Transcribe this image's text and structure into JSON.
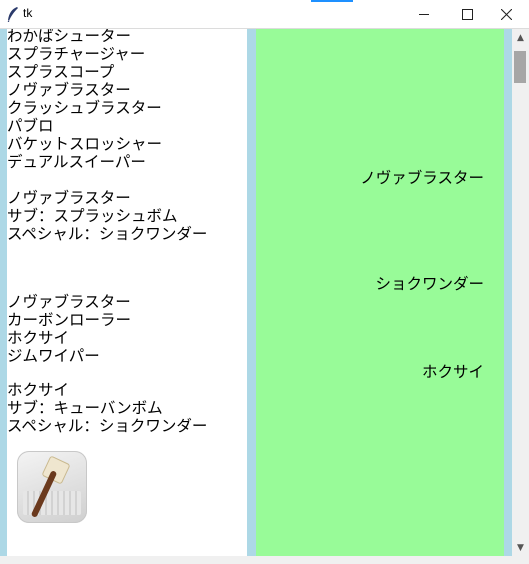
{
  "window": {
    "title": "tk",
    "icon": "feather-icon",
    "buttons": [
      "minimize",
      "maximize",
      "close"
    ]
  },
  "left_panel": {
    "background": "#ffffff",
    "lines": [
      "わかばシューター",
      "スプラチャージャー",
      "スプラスコープ",
      "ノヴァブラスター",
      "クラッシュブラスター",
      "パブロ",
      "バケットスロッシャー",
      "デュアルスイーパー",
      "",
      "ノヴァブラスター",
      "サブ：スプラッシュボム",
      "スペシャル：ショクワンダー",
      "",
      "",
      "",
      "ノヴァブラスター",
      "カーボンローラー",
      "ホクサイ",
      "ジムワイパー",
      "",
      "ホクサイ",
      "サブ：キューバンボム",
      "スペシャル：ショクワンダー"
    ],
    "image": "paintbrush-weapon-icon"
  },
  "right_panel": {
    "background": "#98fb98",
    "labels": [
      "ノヴァブラスター",
      "ショクワンダー",
      "ホクサイ"
    ]
  },
  "colors": {
    "frame": "#add8e6",
    "right_bg": "#98fb98"
  }
}
